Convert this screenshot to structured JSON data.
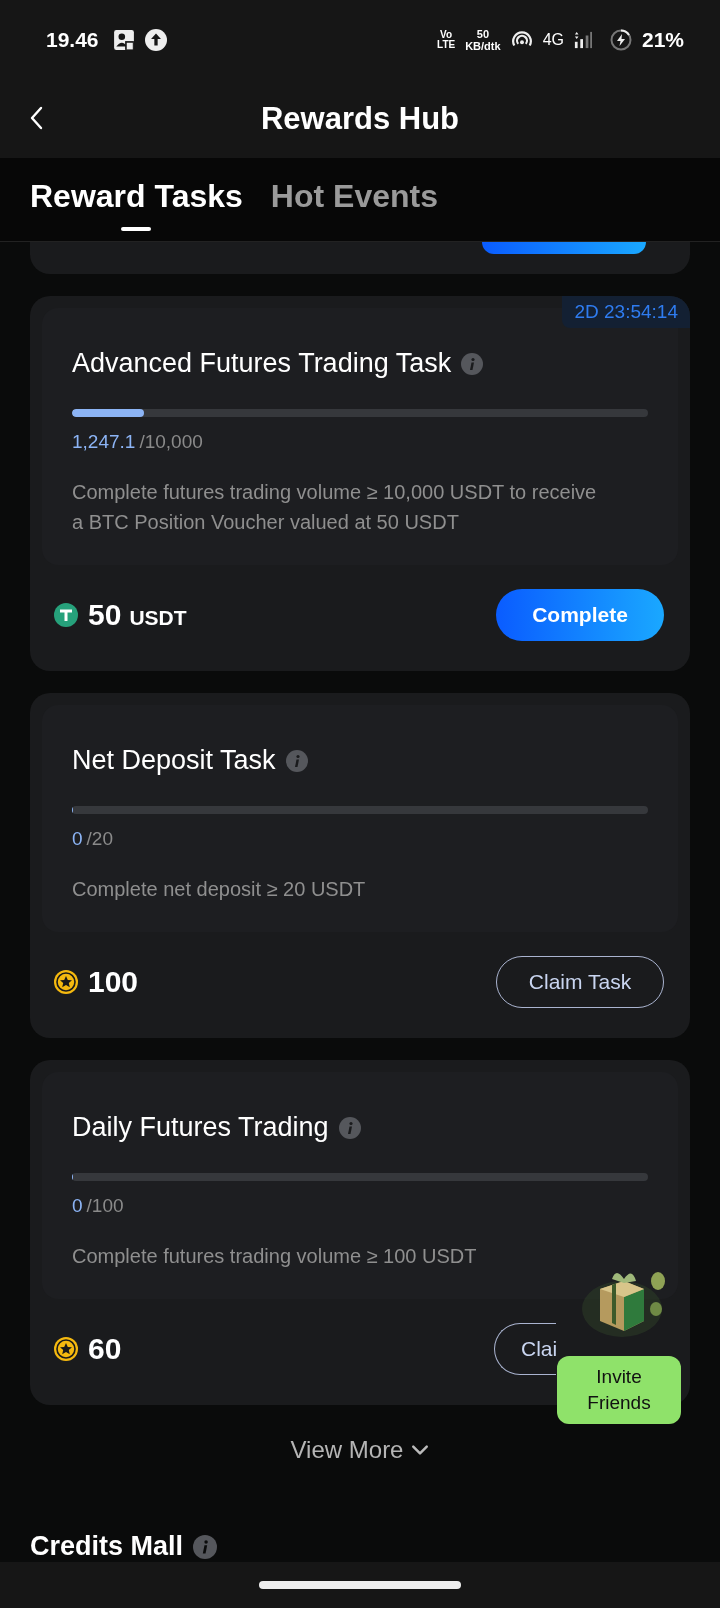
{
  "status_bar": {
    "time": "19.46",
    "volte": [
      "Vo",
      "LTE"
    ],
    "speed": [
      "50",
      "KB/dtk"
    ],
    "network": "4G",
    "battery": "21%"
  },
  "header": {
    "title": "Rewards Hub"
  },
  "tabs": [
    {
      "label": "Reward Tasks",
      "selected": true
    },
    {
      "label": "Hot Events",
      "selected": false
    }
  ],
  "tasks": [
    {
      "timer": "2D 23:54:14",
      "title": "Advanced Futures Trading Task",
      "current": "1,247.1",
      "target": "/10,000",
      "level": 0.125,
      "description": "Complete futures trading volume ≥ 10,000 USDT to receive a BTC Position Voucher valued at 50 USDT",
      "reward": {
        "kind": "usdt",
        "amount": "50",
        "unit": "USDT"
      },
      "button": {
        "label": "Complete",
        "kind": "primary"
      }
    },
    {
      "title": "Net Deposit Task",
      "current": "0",
      "target": "/20",
      "level": 0,
      "description": "Complete net deposit ≥ 20 USDT",
      "reward": {
        "kind": "points",
        "amount": "100"
      },
      "button": {
        "label": "Claim Task",
        "kind": "outline"
      }
    },
    {
      "title": "Daily Futures Trading",
      "current": "0",
      "target": "/100",
      "level": 0,
      "description": "Complete futures trading volume ≥ 100 USDT",
      "reward": {
        "kind": "points",
        "amount": "60"
      },
      "button": {
        "label": "Clai",
        "kind": "outline"
      }
    }
  ],
  "invite_badge": {
    "label": "Invite Friends"
  },
  "view_more": "View More",
  "credits_mall": {
    "title": "Credits Mall"
  }
}
